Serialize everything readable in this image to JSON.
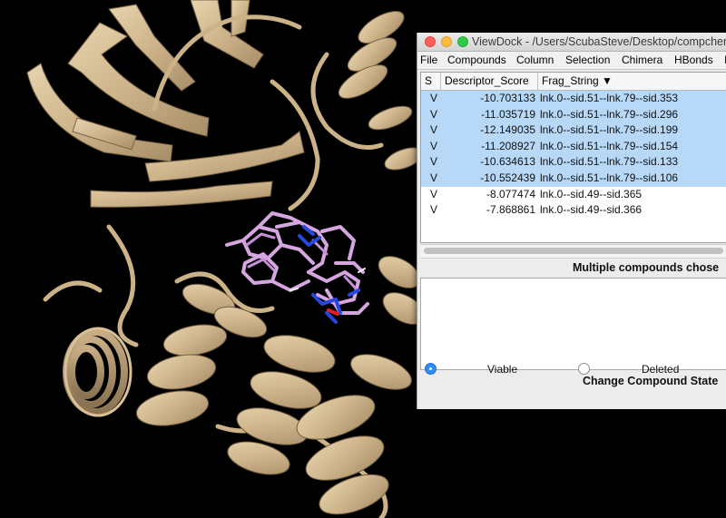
{
  "window": {
    "title": "ViewDock - /Users/ScubaSteve/Desktop/compchems"
  },
  "menu": [
    "File",
    "Compounds",
    "Column",
    "Selection",
    "Chimera",
    "HBonds",
    "I"
  ],
  "table": {
    "columns": [
      "S",
      "Descriptor_Score",
      "Frag_String ▼"
    ],
    "rows": [
      {
        "s": "V",
        "score": "-10.703133",
        "frag": "lnk.0--sid.51--lnk.79--sid.353",
        "selected": true
      },
      {
        "s": "V",
        "score": "-11.035719",
        "frag": "lnk.0--sid.51--lnk.79--sid.296",
        "selected": true
      },
      {
        "s": "V",
        "score": "-12.149035",
        "frag": "lnk.0--sid.51--lnk.79--sid.199",
        "selected": true
      },
      {
        "s": "V",
        "score": "-11.208927",
        "frag": "lnk.0--sid.51--lnk.79--sid.154",
        "selected": true
      },
      {
        "s": "V",
        "score": "-10.634613",
        "frag": "lnk.0--sid.51--lnk.79--sid.133",
        "selected": true
      },
      {
        "s": "V",
        "score": "-10.552439",
        "frag": "lnk.0--sid.51--lnk.79--sid.106",
        "selected": true
      },
      {
        "s": "V",
        "score": "-8.077474",
        "frag": "lnk.0--sid.49--sid.365",
        "selected": false
      },
      {
        "s": "V",
        "score": "-7.868861",
        "frag": "lnk.0--sid.49--sid.366",
        "selected": false
      }
    ]
  },
  "multi_label": "Multiple compounds chose",
  "state_label": "Change Compound State",
  "states": {
    "viable": "Viable",
    "deleted": "Deleted",
    "selected": "viable"
  },
  "colors": {
    "ribbon": "#d2b98f",
    "ligand": "#d6a6e0",
    "nitrogen": "#2748e0",
    "oxygen": "#e02020",
    "selection": "#b7d9f7"
  }
}
